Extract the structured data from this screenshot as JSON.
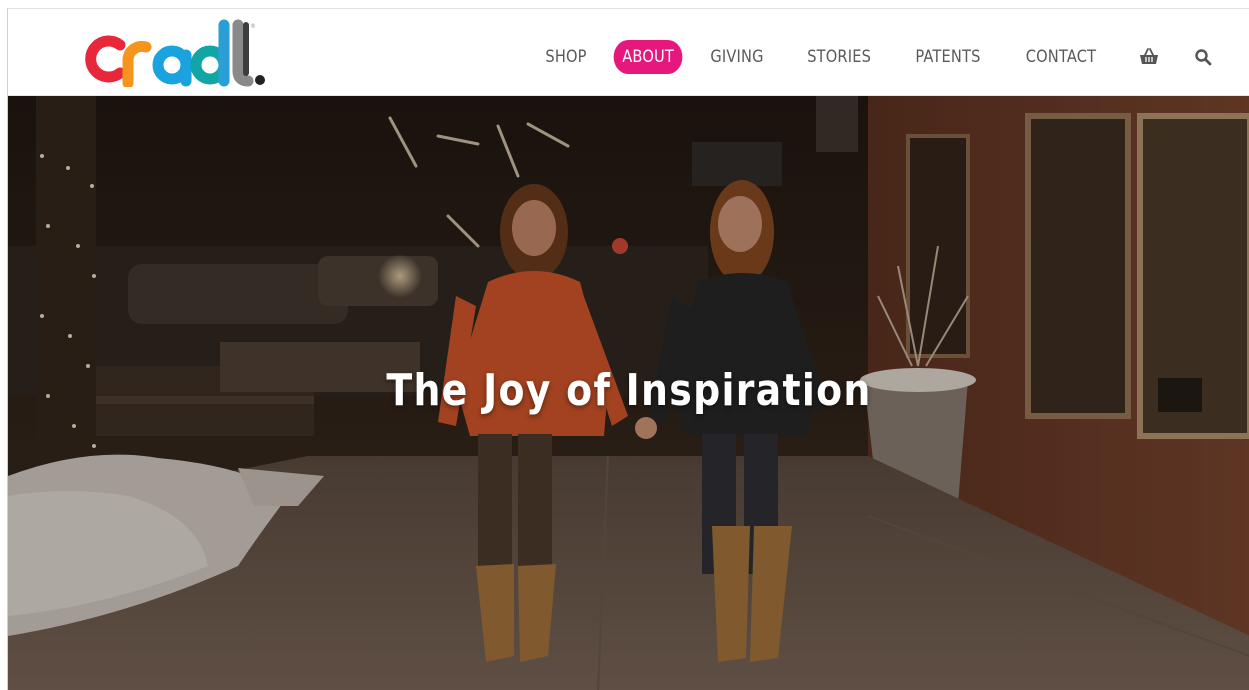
{
  "brand": {
    "logo_text": "cradl."
  },
  "nav": {
    "items": [
      {
        "label": "SHOP",
        "active": false
      },
      {
        "label": "ABOUT",
        "active": true
      },
      {
        "label": "GIVING",
        "active": false
      },
      {
        "label": "STORIES",
        "active": false
      },
      {
        "label": "PATENTS",
        "active": false
      },
      {
        "label": "CONTACT",
        "active": false
      }
    ],
    "icons": [
      "basket-icon",
      "search-icon"
    ]
  },
  "hero": {
    "title": "The Joy of Inspiration",
    "image": "two-women-holding-hands-on-snowy-night-street"
  },
  "colors": {
    "accent": "#e6187e",
    "nav_text": "#5a5a5a",
    "logo_red": "#e8273b",
    "logo_orange": "#f7941d",
    "logo_blue": "#1aa3df",
    "logo_dark": "#3d3d3d"
  }
}
